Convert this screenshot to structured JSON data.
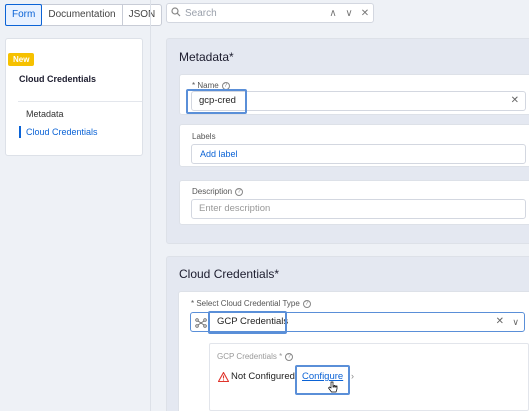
{
  "tabs": [
    "Form",
    "Documentation",
    "JSON"
  ],
  "search": {
    "placeholder": "Search",
    "prev": "∧",
    "next": "∨",
    "close": "✕"
  },
  "sidebar": {
    "badge": "New",
    "title": "Cloud Credentials",
    "items": [
      {
        "label": "Metadata",
        "active": false
      },
      {
        "label": "Cloud Credentials",
        "active": true
      }
    ]
  },
  "metadata": {
    "title": "Metadata",
    "title_required": "*",
    "name_label": "* Name",
    "name_value": "gcp-cred",
    "labels_label": "Labels",
    "add_label": "Add label",
    "description_label": "Description",
    "description_placeholder": "Enter description"
  },
  "cloud": {
    "title": "Cloud Credentials",
    "title_required": "*",
    "type_label": "* Select Cloud Credential Type",
    "type_value": "GCP Credentials",
    "gcp_label": "GCP Credentials *",
    "status": "Not Configured",
    "configure": "Configure",
    "chevron": "›"
  },
  "colors": {
    "accent": "#0b63d6",
    "badge": "#f6c100",
    "warning": "#e0342b"
  },
  "icons": [
    "search-icon",
    "chevron-up-icon",
    "chevron-down-icon",
    "close-icon",
    "info-icon",
    "clear-icon",
    "credential-type-icon",
    "warning-icon",
    "pointer-cursor-icon"
  ]
}
